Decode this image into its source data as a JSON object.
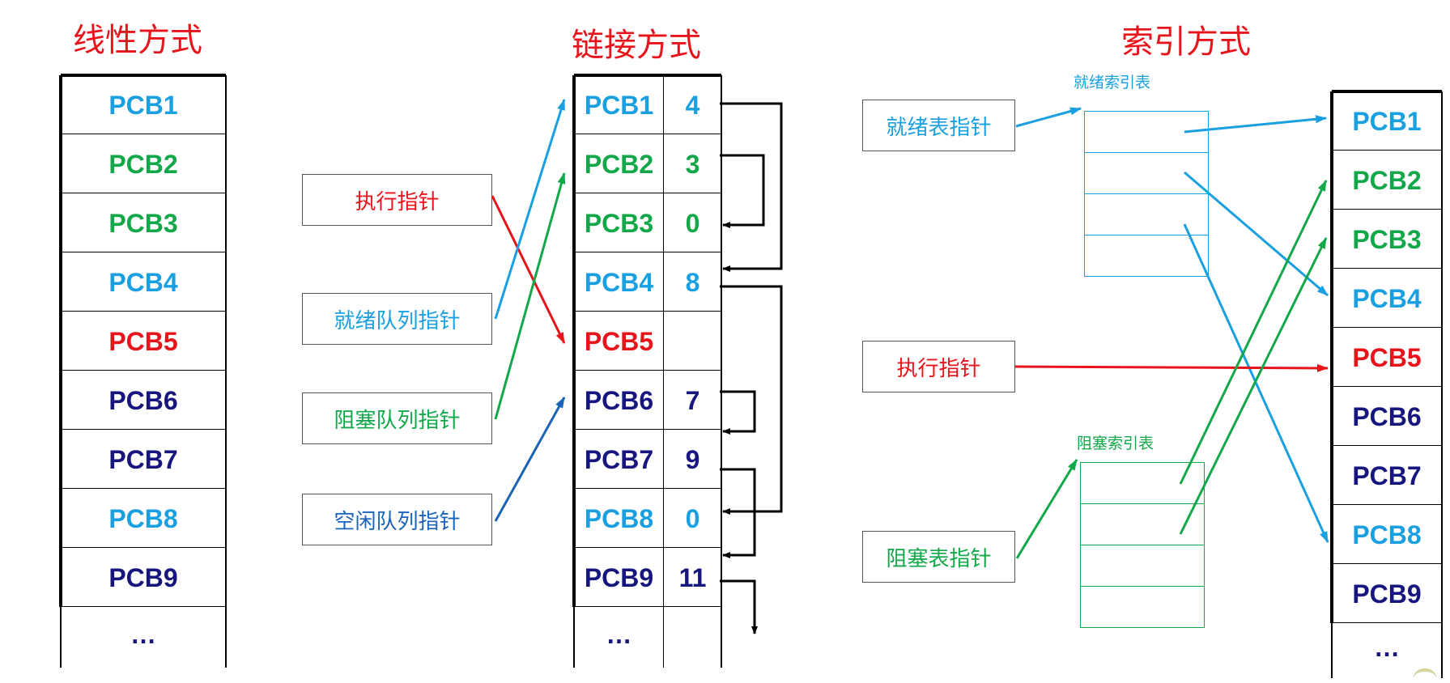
{
  "colors": {
    "red": "#e8141b",
    "light_blue": "#1aa0e0",
    "green": "#12a84a",
    "dark_blue": "#16167e",
    "link_blue": "#1a63b8",
    "black": "#000000"
  },
  "titles": {
    "linear": "线性方式",
    "linked": "链接方式",
    "indexed": "索引方式"
  },
  "linear": {
    "rows": [
      {
        "label": "PCB1",
        "color": "light_blue"
      },
      {
        "label": "PCB2",
        "color": "green"
      },
      {
        "label": "PCB3",
        "color": "green"
      },
      {
        "label": "PCB4",
        "color": "light_blue"
      },
      {
        "label": "PCB5",
        "color": "red"
      },
      {
        "label": "PCB6",
        "color": "dark_blue"
      },
      {
        "label": "PCB7",
        "color": "dark_blue"
      },
      {
        "label": "PCB8",
        "color": "light_blue"
      },
      {
        "label": "PCB9",
        "color": "dark_blue"
      }
    ],
    "ellipsis": "…"
  },
  "linked": {
    "rows": [
      {
        "label": "PCB1",
        "next": "4",
        "color": "light_blue"
      },
      {
        "label": "PCB2",
        "next": "3",
        "color": "green"
      },
      {
        "label": "PCB3",
        "next": "0",
        "color": "green"
      },
      {
        "label": "PCB4",
        "next": "8",
        "color": "light_blue"
      },
      {
        "label": "PCB5",
        "next": "",
        "color": "red"
      },
      {
        "label": "PCB6",
        "next": "7",
        "color": "dark_blue"
      },
      {
        "label": "PCB7",
        "next": "9",
        "color": "dark_blue"
      },
      {
        "label": "PCB8",
        "next": "0",
        "color": "light_blue"
      },
      {
        "label": "PCB9",
        "next": "11",
        "color": "dark_blue"
      }
    ],
    "ellipsis": "…",
    "pointers": [
      {
        "text": "执行指针",
        "color": "red"
      },
      {
        "text": "就绪队列指针",
        "color": "light_blue"
      },
      {
        "text": "阻塞队列指针",
        "color": "green"
      },
      {
        "text": "空闲队列指针",
        "color": "link_blue"
      }
    ]
  },
  "indexed": {
    "rows": [
      {
        "label": "PCB1",
        "color": "light_blue"
      },
      {
        "label": "PCB2",
        "color": "green"
      },
      {
        "label": "PCB3",
        "color": "green"
      },
      {
        "label": "PCB4",
        "color": "light_blue"
      },
      {
        "label": "PCB5",
        "color": "red"
      },
      {
        "label": "PCB6",
        "color": "dark_blue"
      },
      {
        "label": "PCB7",
        "color": "dark_blue"
      },
      {
        "label": "PCB8",
        "color": "light_blue"
      },
      {
        "label": "PCB9",
        "color": "dark_blue"
      }
    ],
    "ellipsis": "…",
    "ready_index_label": "就绪索引表",
    "blocked_index_label": "阻塞索引表",
    "pointers": {
      "ready": "就绪表指针",
      "exec": "执行指针",
      "blocked": "阻塞表指针"
    }
  }
}
